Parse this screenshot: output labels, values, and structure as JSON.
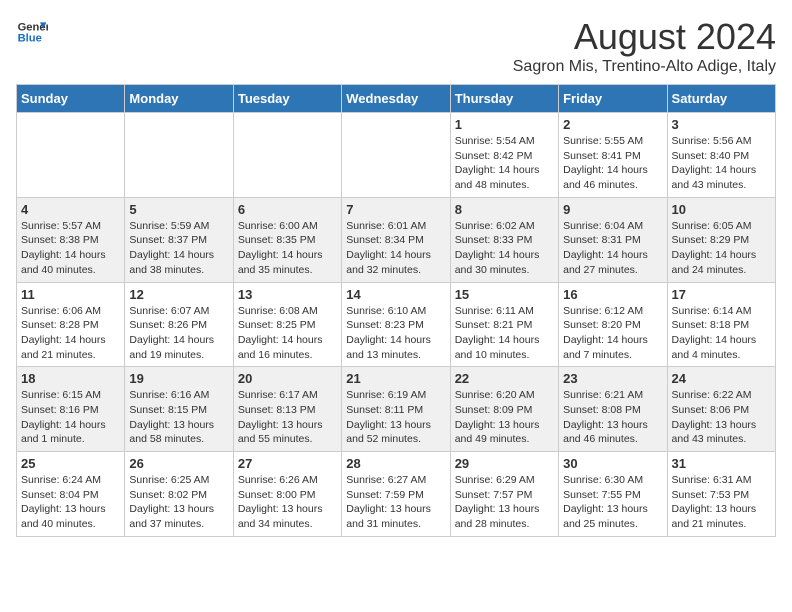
{
  "logo": {
    "line1": "General",
    "line2": "Blue"
  },
  "title": "August 2024",
  "subtitle": "Sagron Mis, Trentino-Alto Adige, Italy",
  "days_of_week": [
    "Sunday",
    "Monday",
    "Tuesday",
    "Wednesday",
    "Thursday",
    "Friday",
    "Saturday"
  ],
  "weeks": [
    [
      {
        "day": "",
        "info": ""
      },
      {
        "day": "",
        "info": ""
      },
      {
        "day": "",
        "info": ""
      },
      {
        "day": "",
        "info": ""
      },
      {
        "day": "1",
        "info": "Sunrise: 5:54 AM\nSunset: 8:42 PM\nDaylight: 14 hours\nand 48 minutes."
      },
      {
        "day": "2",
        "info": "Sunrise: 5:55 AM\nSunset: 8:41 PM\nDaylight: 14 hours\nand 46 minutes."
      },
      {
        "day": "3",
        "info": "Sunrise: 5:56 AM\nSunset: 8:40 PM\nDaylight: 14 hours\nand 43 minutes."
      }
    ],
    [
      {
        "day": "4",
        "info": "Sunrise: 5:57 AM\nSunset: 8:38 PM\nDaylight: 14 hours\nand 40 minutes."
      },
      {
        "day": "5",
        "info": "Sunrise: 5:59 AM\nSunset: 8:37 PM\nDaylight: 14 hours\nand 38 minutes."
      },
      {
        "day": "6",
        "info": "Sunrise: 6:00 AM\nSunset: 8:35 PM\nDaylight: 14 hours\nand 35 minutes."
      },
      {
        "day": "7",
        "info": "Sunrise: 6:01 AM\nSunset: 8:34 PM\nDaylight: 14 hours\nand 32 minutes."
      },
      {
        "day": "8",
        "info": "Sunrise: 6:02 AM\nSunset: 8:33 PM\nDaylight: 14 hours\nand 30 minutes."
      },
      {
        "day": "9",
        "info": "Sunrise: 6:04 AM\nSunset: 8:31 PM\nDaylight: 14 hours\nand 27 minutes."
      },
      {
        "day": "10",
        "info": "Sunrise: 6:05 AM\nSunset: 8:29 PM\nDaylight: 14 hours\nand 24 minutes."
      }
    ],
    [
      {
        "day": "11",
        "info": "Sunrise: 6:06 AM\nSunset: 8:28 PM\nDaylight: 14 hours\nand 21 minutes."
      },
      {
        "day": "12",
        "info": "Sunrise: 6:07 AM\nSunset: 8:26 PM\nDaylight: 14 hours\nand 19 minutes."
      },
      {
        "day": "13",
        "info": "Sunrise: 6:08 AM\nSunset: 8:25 PM\nDaylight: 14 hours\nand 16 minutes."
      },
      {
        "day": "14",
        "info": "Sunrise: 6:10 AM\nSunset: 8:23 PM\nDaylight: 14 hours\nand 13 minutes."
      },
      {
        "day": "15",
        "info": "Sunrise: 6:11 AM\nSunset: 8:21 PM\nDaylight: 14 hours\nand 10 minutes."
      },
      {
        "day": "16",
        "info": "Sunrise: 6:12 AM\nSunset: 8:20 PM\nDaylight: 14 hours\nand 7 minutes."
      },
      {
        "day": "17",
        "info": "Sunrise: 6:14 AM\nSunset: 8:18 PM\nDaylight: 14 hours\nand 4 minutes."
      }
    ],
    [
      {
        "day": "18",
        "info": "Sunrise: 6:15 AM\nSunset: 8:16 PM\nDaylight: 14 hours\nand 1 minute."
      },
      {
        "day": "19",
        "info": "Sunrise: 6:16 AM\nSunset: 8:15 PM\nDaylight: 13 hours\nand 58 minutes."
      },
      {
        "day": "20",
        "info": "Sunrise: 6:17 AM\nSunset: 8:13 PM\nDaylight: 13 hours\nand 55 minutes."
      },
      {
        "day": "21",
        "info": "Sunrise: 6:19 AM\nSunset: 8:11 PM\nDaylight: 13 hours\nand 52 minutes."
      },
      {
        "day": "22",
        "info": "Sunrise: 6:20 AM\nSunset: 8:09 PM\nDaylight: 13 hours\nand 49 minutes."
      },
      {
        "day": "23",
        "info": "Sunrise: 6:21 AM\nSunset: 8:08 PM\nDaylight: 13 hours\nand 46 minutes."
      },
      {
        "day": "24",
        "info": "Sunrise: 6:22 AM\nSunset: 8:06 PM\nDaylight: 13 hours\nand 43 minutes."
      }
    ],
    [
      {
        "day": "25",
        "info": "Sunrise: 6:24 AM\nSunset: 8:04 PM\nDaylight: 13 hours\nand 40 minutes."
      },
      {
        "day": "26",
        "info": "Sunrise: 6:25 AM\nSunset: 8:02 PM\nDaylight: 13 hours\nand 37 minutes."
      },
      {
        "day": "27",
        "info": "Sunrise: 6:26 AM\nSunset: 8:00 PM\nDaylight: 13 hours\nand 34 minutes."
      },
      {
        "day": "28",
        "info": "Sunrise: 6:27 AM\nSunset: 7:59 PM\nDaylight: 13 hours\nand 31 minutes."
      },
      {
        "day": "29",
        "info": "Sunrise: 6:29 AM\nSunset: 7:57 PM\nDaylight: 13 hours\nand 28 minutes."
      },
      {
        "day": "30",
        "info": "Sunrise: 6:30 AM\nSunset: 7:55 PM\nDaylight: 13 hours\nand 25 minutes."
      },
      {
        "day": "31",
        "info": "Sunrise: 6:31 AM\nSunset: 7:53 PM\nDaylight: 13 hours\nand 21 minutes."
      }
    ]
  ]
}
